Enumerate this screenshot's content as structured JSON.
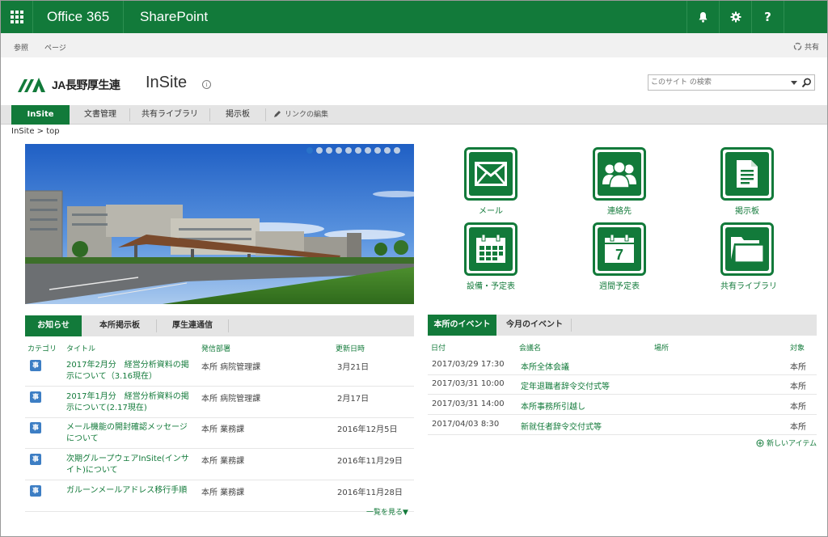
{
  "suitebar": {
    "brand": "Office 365",
    "product": "SharePoint",
    "help_label": "?",
    "bg_color": "#127a3a"
  },
  "ribbon": {
    "browse_label": "参照",
    "page_label": "ページ",
    "share_label": "共有"
  },
  "site": {
    "logo_text": "JA長野厚生連",
    "title": "InSite",
    "info_glyph": "i",
    "search_placeholder": "このサイト の検索"
  },
  "nav": {
    "tabs": [
      {
        "label": "InSite",
        "active": true
      },
      {
        "label": "文書管理"
      },
      {
        "label": "共有ライブラリ"
      },
      {
        "label": "掲示板"
      }
    ],
    "edit_links_label": "リンクの編集"
  },
  "breadcrumb": "InSite > top",
  "hero": {
    "dot_count": 10,
    "active_dot": 0
  },
  "tiles": [
    {
      "label": "メール",
      "icon": "mail-icon"
    },
    {
      "label": "連絡先",
      "icon": "contacts-icon"
    },
    {
      "label": "掲示板",
      "icon": "document-icon"
    },
    {
      "label": "設備・予定表",
      "icon": "calendar-icon"
    },
    {
      "label": "週間予定表",
      "icon": "weekly-calendar-icon"
    },
    {
      "label": "共有ライブラリ",
      "icon": "folder-icon"
    }
  ],
  "tile_calendar_day": "7",
  "news": {
    "tabs": [
      "お知らせ",
      "本所掲示板",
      "厚生連通信"
    ],
    "columns": {
      "category": "カテゴリ",
      "title": "タイトル",
      "dept": "発信部署",
      "updated": "更新日時"
    },
    "rows": [
      {
        "cat": "事",
        "title": "2017年2月分　経営分析資料の掲示について（3.16現在）",
        "dept": "本所 病院管理課",
        "date": "3月21日"
      },
      {
        "cat": "事",
        "title": "2017年1月分　経営分析資料の掲示について(2.17現在)",
        "dept": "本所 病院管理課",
        "date": "2月17日"
      },
      {
        "cat": "事",
        "title": "メール機能の開封確認メッセージについて",
        "dept": "本所 業務課",
        "date": "2016年12月5日"
      },
      {
        "cat": "事",
        "title": "次期グループウェアInSite(インサイト)について",
        "dept": "本所 業務課",
        "date": "2016年11月29日"
      },
      {
        "cat": "事",
        "title": "ガルーンメールアドレス移行手順",
        "dept": "本所 業務課",
        "date": "2016年11月28日"
      }
    ],
    "more_label": "一覧を見る▼"
  },
  "events": {
    "tabs": [
      "本所のイベント",
      "今月のイベント"
    ],
    "columns": {
      "date": "日付",
      "title": "会議名",
      "place": "場所",
      "target": "対象"
    },
    "rows": [
      {
        "date": "2017/03/29 17:30",
        "title": "本所全体会議",
        "target": "本所"
      },
      {
        "date": "2017/03/31 10:00",
        "title": "定年退職者辞令交付式等",
        "target": "本所"
      },
      {
        "date": "2017/03/31 14:00",
        "title": "本所事務所引越し",
        "target": "本所"
      },
      {
        "date": "2017/04/03 8:30",
        "title": "新就任者辞令交付式等",
        "target": "本所"
      }
    ],
    "new_item_label": "新しいアイテム"
  }
}
